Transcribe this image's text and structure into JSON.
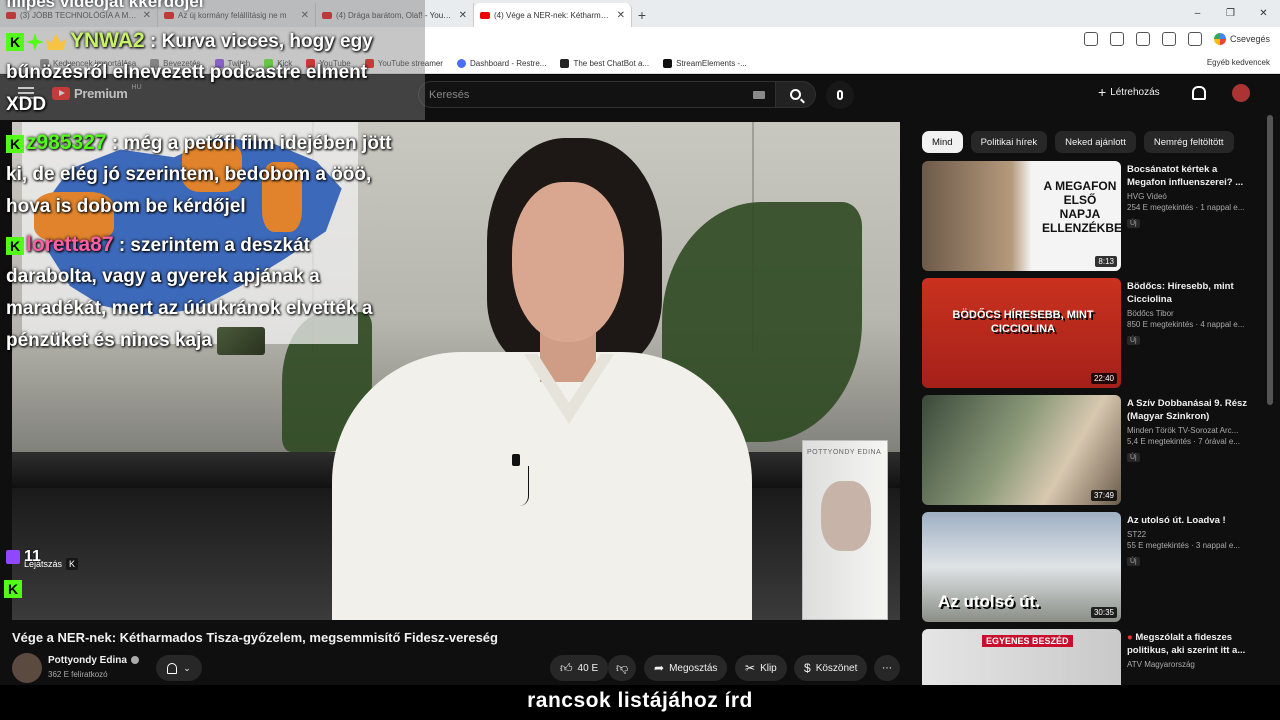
{
  "browser": {
    "tabs": [
      {
        "label": "(3) JÓBB TECHNOLÓGIA A MAGYAR...",
        "active": false
      },
      {
        "label": "Az új kormány felállításig ne m",
        "active": false
      },
      {
        "label": "(4) Drága barátom, Olaf! - YouTube",
        "active": false
      },
      {
        "label": "(4) Vége a NER-nek: Kétharmados",
        "active": true
      }
    ],
    "new_tab": "+",
    "window_controls": [
      "–",
      "❐",
      "✕"
    ],
    "profile_label": "Csevegés",
    "bookmarks": [
      "Kedvencek importálása",
      "Bevezetés",
      "Twitch",
      "Kick",
      "YouTube",
      "YouTube streamer",
      "Dashboard - Restre...",
      "The best ChatBot a...",
      "StreamElements -..."
    ],
    "bookmarks_right": "Egyéb kedvencek"
  },
  "youtube": {
    "logo_text": "Premium",
    "logo_region": "HU",
    "search_placeholder": "Keresés",
    "create_label": "Létrehozás",
    "video": {
      "title": "Vége a NER-nek: Kétharmados Tisza-győzelem, megsemmisítő Fidesz-vereség",
      "play_hint": "Lejátszás",
      "play_key": "K",
      "book_title": "POTTYONDY EDINA"
    },
    "channel": {
      "name": "Pottyondy Edina",
      "subs": "362 E feliratkozó"
    },
    "actions": {
      "like": "40 E",
      "share": "Megosztás",
      "clip": "Klip",
      "thanks": "Köszönet",
      "more": "⋯"
    },
    "chips": [
      "Mind",
      "Politikai hírek",
      "Neked ajánlott",
      "Nemrég feltöltött"
    ],
    "recommendations": [
      {
        "title": "Bocsánatot kértek a Megafon influenszerei? ...",
        "channel": "HVG Videó",
        "meta": "254 E megtekintés · 1 nappal e...",
        "badge": "Új",
        "duration": "8:13",
        "thumb_text": "A MEGAFON ELSŐ NAPJA ELLENZÉKBEN"
      },
      {
        "title": "Bödőcs: Híresebb, mint Cicciolina",
        "channel": "Bödőcs Tibor",
        "meta": "850 E megtekintés · 4 nappal e...",
        "badge": "Új",
        "duration": "22:40",
        "thumb_text": "BÖDŐCS HÍRESEBB, MINT CICCIOLINA"
      },
      {
        "title": "A Szív Dobbanásai 9. Rész (Magyar Szinkron)",
        "channel": "Minden Török TV-Sorozat Arc...",
        "meta": "5,4 E megtekintés · 7 órával e...",
        "badge": "Új",
        "duration": "37:49",
        "thumb_text": ""
      },
      {
        "title": "Az utolsó út. Loadva !",
        "channel": "ST22",
        "meta": "55 E megtekintés · 3 nappal e...",
        "badge": "Új",
        "duration": "30:35",
        "thumb_text": "Az utolsó út."
      },
      {
        "title": "Megszólalt a fideszes politikus, aki szerint itt a...",
        "channel": "ATV Magyarország",
        "meta": "",
        "badge": "",
        "duration": "",
        "thumb_text": "EGYENES BESZÉD"
      }
    ]
  },
  "chat": {
    "header": "filipes videoját kkérdőjel",
    "messages": [
      {
        "user": "YNWA2",
        "user_color": "#c8f26a",
        "lines": [
          " : Kurva vicces, hogy egy",
          "bűnözésről elnevezett podcastre elment",
          "XDD"
        ]
      },
      {
        "user": "z985327",
        "user_color": "#53fc18",
        "lines": [
          " : még a petőfi film idejében jött",
          "ki, de elég jó szerintem, bedobom a ööö,",
          "hova is dobom be kérdőjel"
        ]
      },
      {
        "user": "loretta87",
        "user_color": "#ff5fa2",
        "lines": [
          " : szerintem a deszkát",
          "darabolta, vagy a gyerek apjának a",
          "maradékát, mert az úúukránok elvették a",
          "pénzüket és nincs kaja"
        ]
      }
    ],
    "viewer_count": "11"
  },
  "caption": "rancsok listájához írd",
  "colors": {
    "yt_bg": "#0f0f0f",
    "accent_red": "#ff0000",
    "kick_green": "#53fc18"
  }
}
